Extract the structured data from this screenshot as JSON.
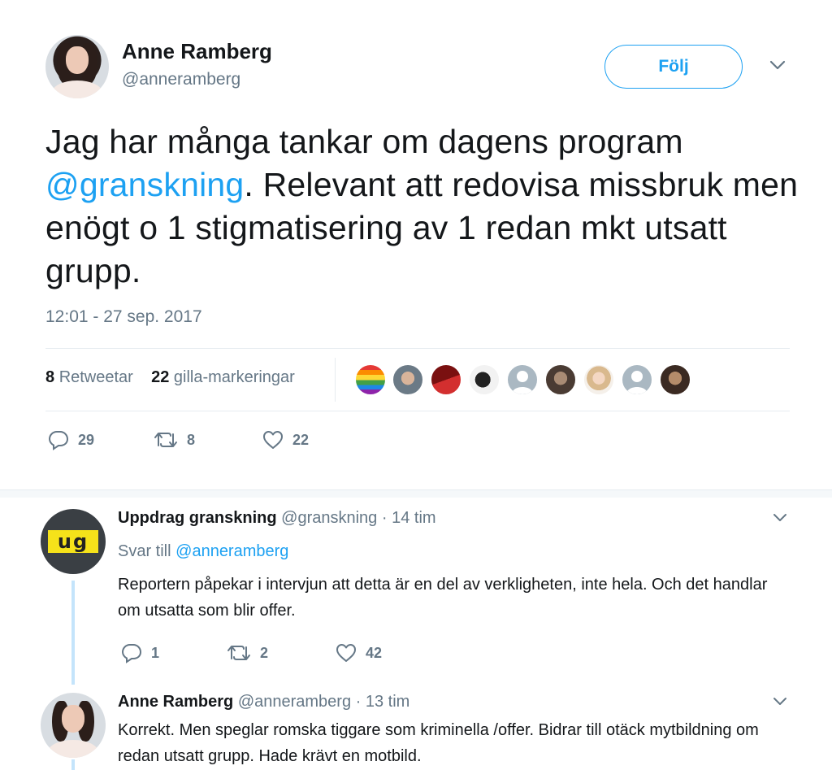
{
  "main_tweet": {
    "author_name": "Anne Ramberg",
    "author_handle": "@anneramberg",
    "follow_label": "Följ",
    "text_part1": "Jag har många tankar om dagens program ",
    "mention": "@granskning",
    "text_part2": ". Relevant att redovisa missbruk men enögt o 1 stigmatisering av 1 redan mkt utsatt grupp.",
    "timestamp": "12:01 - 27 sep. 2017",
    "retweets_count": "8",
    "retweets_label": "Retweetar",
    "likes_count": "22",
    "likes_label": "gilla-markeringar",
    "actions": {
      "replies": "29",
      "retweets": "8",
      "likes": "22"
    }
  },
  "replies": [
    {
      "name": "Uppdrag granskning",
      "handle": "@granskning",
      "time": "14 tim",
      "reply_to_label": "Svar till",
      "reply_to": "@anneramberg",
      "avatar_text": "ug",
      "text": "Reportern påpekar i intervjun att detta är en del av verkligheten, inte hela. Och det handlar om utsatta som blir offer.",
      "actions": {
        "replies": "1",
        "retweets": "2",
        "likes": "42"
      }
    },
    {
      "name": "Anne Ramberg",
      "handle": "@anneramberg",
      "time": "13 tim",
      "text": "Korrekt. Men speglar romska tiggare som kriminella /offer. Bidrar till otäck mytbildning om redan utsatt grupp. Hade krävt en motbild."
    }
  ],
  "icons": {
    "chevron": "chevron-down-icon",
    "reply": "reply-icon",
    "retweet": "retweet-icon",
    "like": "heart-icon"
  },
  "colors": {
    "accent": "#1da1f2",
    "muted": "#657786",
    "text": "#14171a",
    "thread_line": "#c4e4fb"
  }
}
